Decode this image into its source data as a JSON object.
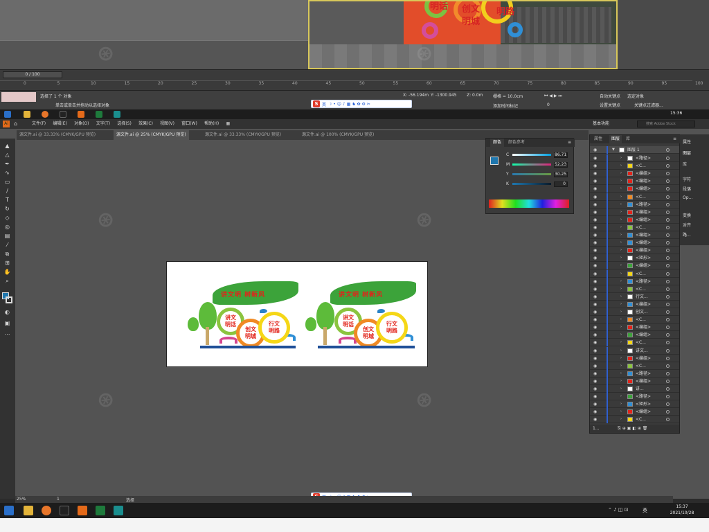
{
  "max": {
    "frame_counter": "0 / 100",
    "timeline_ticks": [
      "0",
      "5",
      "10",
      "15",
      "20",
      "25",
      "30",
      "35",
      "40",
      "45",
      "50",
      "55",
      "60",
      "65",
      "70",
      "75",
      "80",
      "85",
      "90",
      "95",
      "100"
    ],
    "status_selected": "选择了 1 个 对象",
    "status_hint": "单击或单击并拖动以选择对象",
    "status_hint2": "自动关键点",
    "x_field": "X: -56.194m",
    "y_field": "Y: -1300.945",
    "z_field": "Z: 0.0m",
    "grid": "栅格 = 10.0cm",
    "add_time_tag": "添加时间标记",
    "set_key": "设置关键点",
    "selected_object": "选定对象",
    "key_filter": "关键点过滤器...",
    "frame_value": "0",
    "scene_text": [
      "明话",
      "创文",
      "明城",
      "明路"
    ],
    "clock": "15:36"
  },
  "ime": {
    "logo": "S",
    "lang": "英"
  },
  "ai": {
    "menu": [
      "文件(F)",
      "编辑(E)",
      "对象(O)",
      "文字(T)",
      "选择(S)",
      "效果(C)",
      "视图(V)",
      "窗口(W)",
      "帮助(H)"
    ],
    "workspace": "基本功能",
    "search_placeholder": "搜索 Adobe Stock",
    "tabs": [
      "源文件.ai @ 33.33% (CMYK/GPU 预览)",
      "源文件.ai @ 25% (CMYK/GPU 预览)",
      "源文件.ai @ 33.33% (CMYK/GPU 预览)",
      "源文件.ai @ 100% (CMYK/GPU 预览)"
    ],
    "zoom": "25%",
    "artboard_num": "1",
    "status_tool": "选择"
  },
  "artwork": {
    "slogan": "讲文明 树新风",
    "disc1": [
      "讲文",
      "明话"
    ],
    "disc2": [
      "创文",
      "明城"
    ],
    "disc3": [
      "行文",
      "明路"
    ],
    "colors": {
      "leaf": "#3ca33a",
      "red": "#e2231a",
      "ring1": "#8bc43f",
      "ring2": "#f08a24",
      "ring3": "#f5d717",
      "base": "#1f4f97"
    }
  },
  "color_panel": {
    "tab1": "颜色",
    "tab2": "颜色参考",
    "channels": [
      {
        "label": "C",
        "value": "86.71",
        "unit": "%"
      },
      {
        "label": "M",
        "value": "52.23",
        "unit": "%"
      },
      {
        "label": "Y",
        "value": "30.25",
        "unit": "%"
      },
      {
        "label": "K",
        "value": "0",
        "unit": "%"
      }
    ]
  },
  "layers_panel": {
    "tab1": "属性",
    "tab2": "图层",
    "tab3": "库",
    "layer_name": "图层 1",
    "footer": "1...",
    "items": [
      "<路径>",
      "<C...",
      "<编组>",
      "<编组>",
      "<编组>",
      "<C...",
      "<路径>",
      "<编组>",
      "<编组>",
      "<C...",
      "<编组>",
      "<编组>",
      "<编组>",
      "<矩形>",
      "<编组>",
      "<C...",
      "<路径>",
      "<C...",
      "行文...",
      "<编组>",
      "创文...",
      "<C...",
      "<编组>",
      "<编组>",
      "<C...",
      "讲文...",
      "<编组>",
      "<C...",
      "<路径>",
      "<编组>",
      "讲...",
      "<路径>",
      "<矩形>",
      "<编组>",
      "<C..."
    ]
  },
  "right_dock": [
    "属性",
    "图层",
    "库",
    "字符",
    "段落",
    "Op...",
    "变换",
    "对齐",
    "路..."
  ],
  "taskbar": {
    "time": "15:37",
    "date": "2021/10/28",
    "ime": "英"
  },
  "watermark": "我图网"
}
